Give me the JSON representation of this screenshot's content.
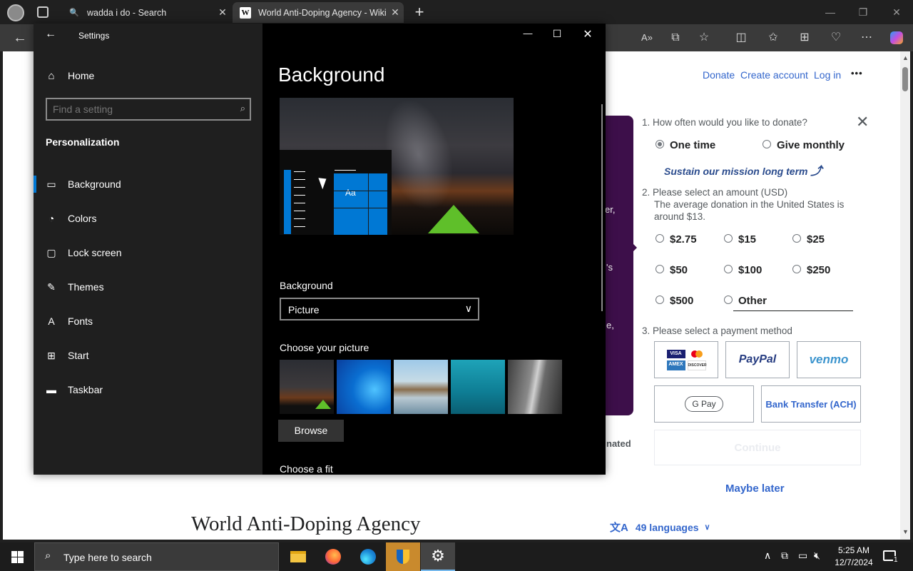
{
  "browser": {
    "tabs": [
      {
        "title": "wadda i do - Search",
        "icon": "search-icon"
      },
      {
        "title": "World Anti-Doping Agency - Wiki",
        "icon": "wikipedia-icon"
      }
    ],
    "new_tab_symbol": "+"
  },
  "wiki": {
    "header_links": {
      "donate": "Donate",
      "create_account": "Create account",
      "log_in": "Log in",
      "more": "•••"
    },
    "article_title": "World Anti-Doping Agency",
    "languages": "49 languages",
    "banner_fragments": [
      "er,",
      "'s",
      "e,",
      "nated"
    ]
  },
  "donation": {
    "q1": "1. How often would you like to donate?",
    "one_time": "One time",
    "give_monthly": "Give monthly",
    "sustain": "Sustain our mission long term",
    "q2": "2. Please select an amount (USD)",
    "q2_note_1": "The average donation in the United States is",
    "q2_note_2": "around $13.",
    "amounts": [
      "$2.75",
      "$15",
      "$25",
      "$50",
      "$100",
      "$250",
      "$500",
      "Other"
    ],
    "q3": "3. Please select a payment method",
    "card_labels": [
      "VISA",
      "AMEX",
      "DISCOVER"
    ],
    "paypal": "PayPal",
    "venmo": "venmo",
    "gpay": "G Pay",
    "bank": "Bank Transfer (ACH)",
    "continue": "Continue",
    "maybe_later": "Maybe later"
  },
  "settings": {
    "window_title": "Settings",
    "home": "Home",
    "search_placeholder": "Find a setting",
    "section": "Personalization",
    "nav": [
      {
        "label": "Background",
        "icon": "picture-icon"
      },
      {
        "label": "Colors",
        "icon": "palette-icon"
      },
      {
        "label": "Lock screen",
        "icon": "lock-screen-icon"
      },
      {
        "label": "Themes",
        "icon": "themes-icon"
      },
      {
        "label": "Fonts",
        "icon": "fonts-icon"
      },
      {
        "label": "Start",
        "icon": "start-icon"
      },
      {
        "label": "Taskbar",
        "icon": "taskbar-icon"
      }
    ],
    "page_title": "Background",
    "preview_tile_text": "Aa",
    "background_label": "Background",
    "background_value": "Picture",
    "choose_picture": "Choose your picture",
    "browse": "Browse",
    "choose_fit": "Choose a fit"
  },
  "taskbar": {
    "search_placeholder": "Type here to search",
    "time": "5:25 AM",
    "date": "12/7/2024",
    "notification_count": "1"
  },
  "colors": {
    "accent": "#0078d4",
    "wiki_link": "#3366cc",
    "banner": "#3d0f4a"
  }
}
